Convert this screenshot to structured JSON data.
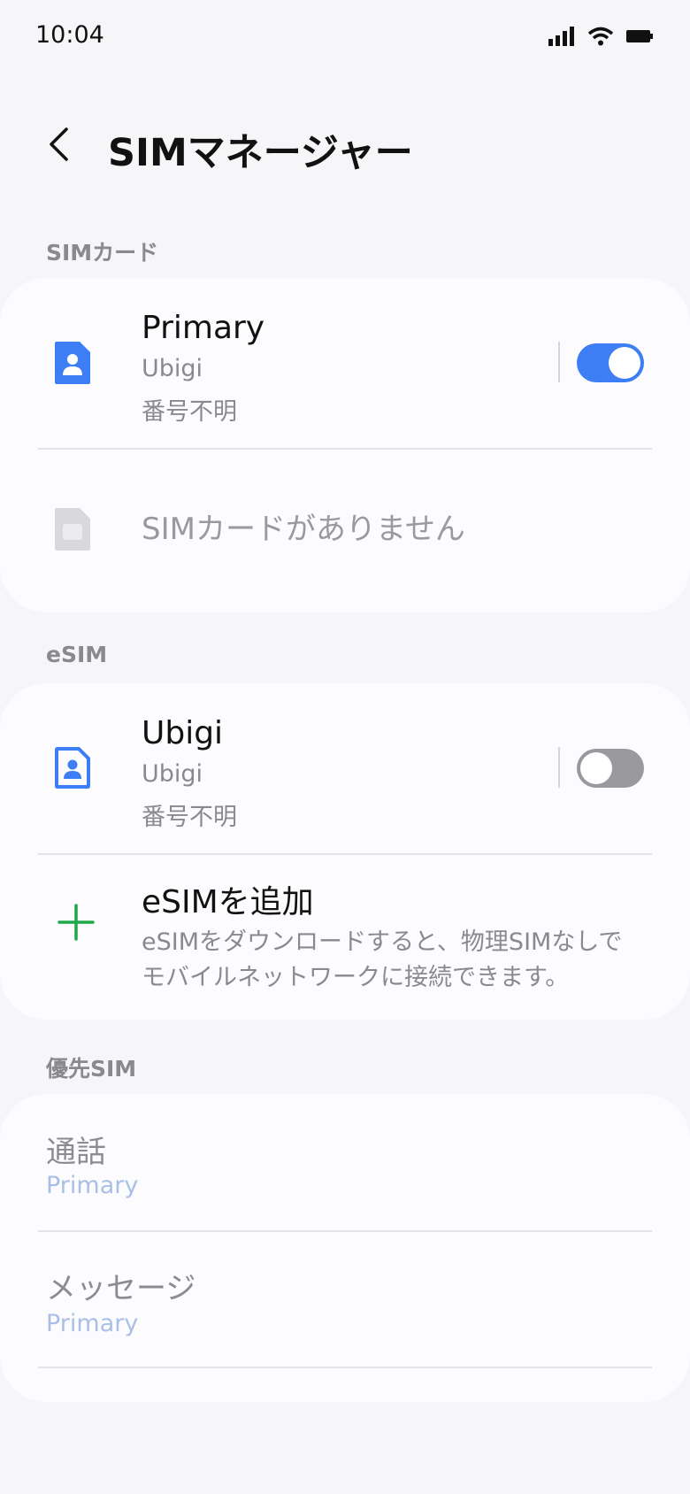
{
  "status_bar": {
    "time": "10:04"
  },
  "header": {
    "title": "SIMマネージャー"
  },
  "sim_section": {
    "label": "SIMカード",
    "primary": {
      "title": "Primary",
      "carrier": "Ubigi",
      "number": "番号不明",
      "enabled": true
    },
    "empty_slot": {
      "label": "SIMカードがありません"
    }
  },
  "esim_section": {
    "label": "eSIM",
    "ubigi": {
      "title": "Ubigi",
      "carrier": "Ubigi",
      "number": "番号不明",
      "enabled": false
    },
    "add": {
      "title": "eSIMを追加",
      "description_line1": "eSIMをダウンロードすると、物理SIMなしで",
      "description_line2": "モバイルネットワークに接続できます。"
    }
  },
  "preferred_section": {
    "label": "優先SIM",
    "calls": {
      "title": "通話",
      "value": "Primary"
    },
    "messages": {
      "title": "メッセージ",
      "value": "Primary"
    }
  },
  "colors": {
    "accent": "#3d7ef5",
    "add_icon": "#1ea84a",
    "disabled_text": "#a9bfe6"
  }
}
